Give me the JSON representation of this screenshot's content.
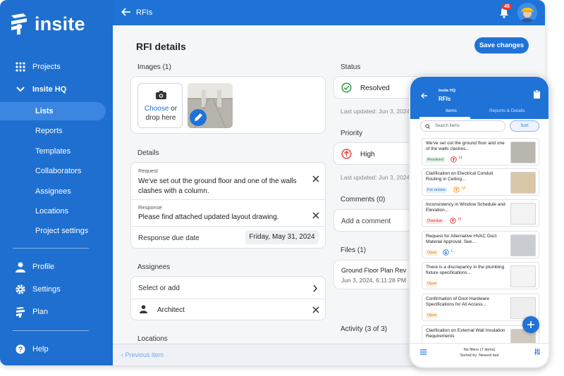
{
  "brand": {
    "name": "insite"
  },
  "sidebar": {
    "items": [
      {
        "label": "Projects"
      },
      {
        "label": "Insite HQ"
      },
      {
        "label": "Lists"
      },
      {
        "label": "Reports"
      },
      {
        "label": "Templates"
      },
      {
        "label": "Collaborators"
      },
      {
        "label": "Assignees"
      },
      {
        "label": "Locations"
      },
      {
        "label": "Project settings"
      },
      {
        "label": "Profile"
      },
      {
        "label": "Settings"
      },
      {
        "label": "Plan"
      },
      {
        "label": "Help"
      }
    ]
  },
  "topbar": {
    "title": "RFIs",
    "notifications": "45"
  },
  "main": {
    "title": "RFI details",
    "save_label": "Save changes",
    "images": {
      "label": "Images (1)",
      "choose": "Choose",
      "or": " or",
      "drop": "drop here"
    },
    "details": {
      "label": "Details",
      "request_label": "Request",
      "request_value": "We've set out the ground floor and one of the walls clashes with a column.",
      "response_label": "Response",
      "response_value": "Please find attached updated layout drawing.",
      "due_label": "Response due date",
      "due_value": "Friday, May 31, 2024"
    },
    "assignees": {
      "label": "Assignees",
      "select": "Select or add",
      "item": "Architect"
    },
    "locations": {
      "label": "Locations"
    },
    "status": {
      "label": "Status",
      "value": "Resolved",
      "updated": "Last updated: Jun 3, 2024"
    },
    "priority": {
      "label": "Priority",
      "value": "High",
      "updated": "Last updated: Jun 3, 2024"
    },
    "comments": {
      "label": "Comments (0)",
      "add": "Add a comment"
    },
    "files": {
      "label": "Files (1)",
      "name": "Ground Floor Plan Rev",
      "date": "Jun 3, 2024, 6:11:28 PM"
    },
    "activity": {
      "label": "Activity (3 of 3)"
    }
  },
  "footer": {
    "prev": "Previous item"
  },
  "phone": {
    "org": "Insite HQ",
    "title": "RFIs",
    "tabs": [
      "Items",
      "Reports & Details"
    ],
    "search_placeholder": "Search items",
    "sort": "Sort",
    "items": [
      {
        "title": "We've set out the ground floor and one of the walls clashes...",
        "status": "Resolved",
        "status_color": "#2e7d32",
        "status_bg": "#e3f4e6",
        "prio": "H",
        "prio_color": "#e53935"
      },
      {
        "title": "Clarification on Electrical Conduit Routing in Ceiling...",
        "status": "For review",
        "status_color": "#1f73d6",
        "status_bg": "#e3eefb",
        "prio": "M",
        "prio_color": "#f29b18"
      },
      {
        "title": "Inconsistency in Window Schedule and Elevation...",
        "status": "Overdue",
        "status_color": "#d32f2f",
        "status_bg": "#fde7e7",
        "prio": "H",
        "prio_color": "#e53935"
      },
      {
        "title": "Request for Alternative HVAC Duct Material Approval. See...",
        "status": "Open",
        "status_color": "#e27b0c",
        "status_bg": "#fdf0e0",
        "prio": "L",
        "prio_color": "#1f73d6"
      },
      {
        "title": "There is a discrepancy in the plumbing fixture specifications...",
        "status": "Open",
        "status_color": "#e27b0c",
        "status_bg": "#fdf0e0",
        "prio": "",
        "prio_color": "#999"
      },
      {
        "title": "Confirmation of Door Hardware Specifications for All Access...",
        "status": "Open",
        "status_color": "#e27b0c",
        "status_bg": "#fdf0e0",
        "prio": "",
        "prio_color": "#999"
      },
      {
        "title": "Clarification on External Wall Insulation Requirements",
        "status": "",
        "status_color": "#2e7d32",
        "status_bg": "#e3f4e6",
        "prio": "",
        "prio_color": "#999"
      }
    ],
    "filters": "No filters (7 items)",
    "sorted": "Sorted by: Newest last"
  }
}
